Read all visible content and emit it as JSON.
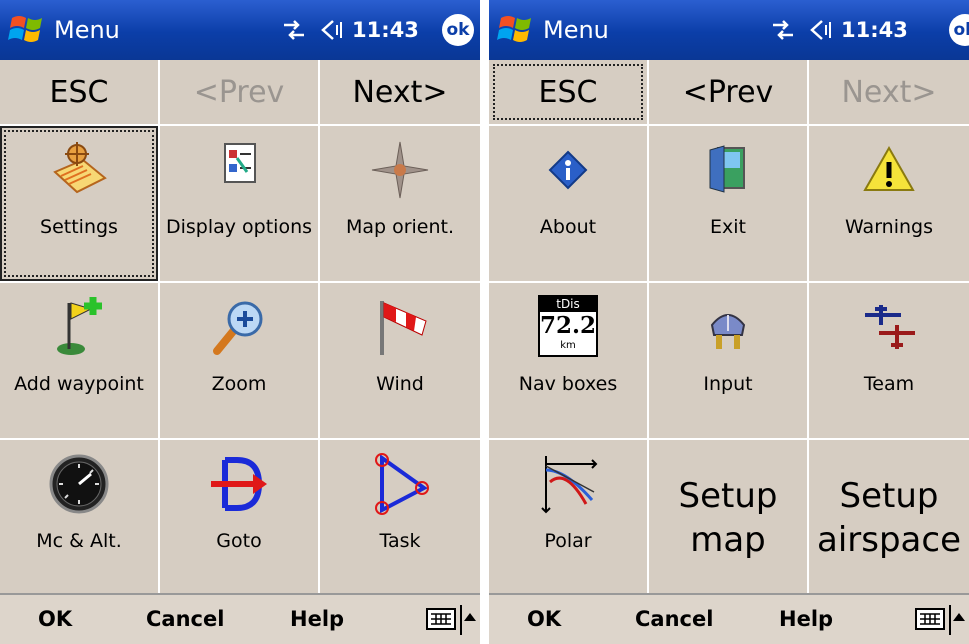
{
  "screens": [
    {
      "title": "Menu",
      "clock": "11:43",
      "ok": "ok",
      "nav": {
        "esc": "ESC",
        "prev": "<Prev",
        "next": "Next>"
      },
      "tiles": [
        {
          "label": "Settings",
          "icon": "settings-icon"
        },
        {
          "label": "Display options",
          "icon": "display-options-icon"
        },
        {
          "label": "Map orient.",
          "icon": "compass-icon"
        },
        {
          "label": "Add waypoint",
          "icon": "add-waypoint-icon"
        },
        {
          "label": "Zoom",
          "icon": "zoom-icon"
        },
        {
          "label": "Wind",
          "icon": "windsock-icon"
        },
        {
          "label": "Mc & Alt.",
          "icon": "altimeter-icon"
        },
        {
          "label": "Goto",
          "icon": "goto-icon"
        },
        {
          "label": "Task",
          "icon": "task-icon"
        }
      ],
      "menubar": {
        "ok": "OK",
        "cancel": "Cancel",
        "help": "Help"
      }
    },
    {
      "title": "Menu",
      "clock": "11:43",
      "ok": "ok",
      "nav": {
        "esc": "ESC",
        "prev": "<Prev",
        "next": "Next>"
      },
      "tiles": [
        {
          "label": "About",
          "icon": "info-icon"
        },
        {
          "label": "Exit",
          "icon": "exit-door-icon"
        },
        {
          "label": "Warnings",
          "icon": "warning-icon"
        },
        {
          "label": "Nav boxes",
          "icon": "nav-boxes-icon",
          "box_top": "tDis",
          "box_value": "72.2",
          "box_unit": "km"
        },
        {
          "label": "Input",
          "icon": "input-plug-icon"
        },
        {
          "label": "Team",
          "icon": "team-gliders-icon"
        },
        {
          "label": "Polar",
          "icon": "polar-chart-icon"
        },
        {
          "label": "Setup map",
          "line1": "Setup",
          "line2": "map"
        },
        {
          "label": "Setup airspace",
          "line1": "Setup",
          "line2": "airspace"
        }
      ],
      "menubar": {
        "ok": "OK",
        "cancel": "Cancel",
        "help": "Help"
      }
    }
  ],
  "colors": {
    "titlebar": "#0b3ea8",
    "panel": "#d6cdc2",
    "disabled": "#9a9590"
  }
}
